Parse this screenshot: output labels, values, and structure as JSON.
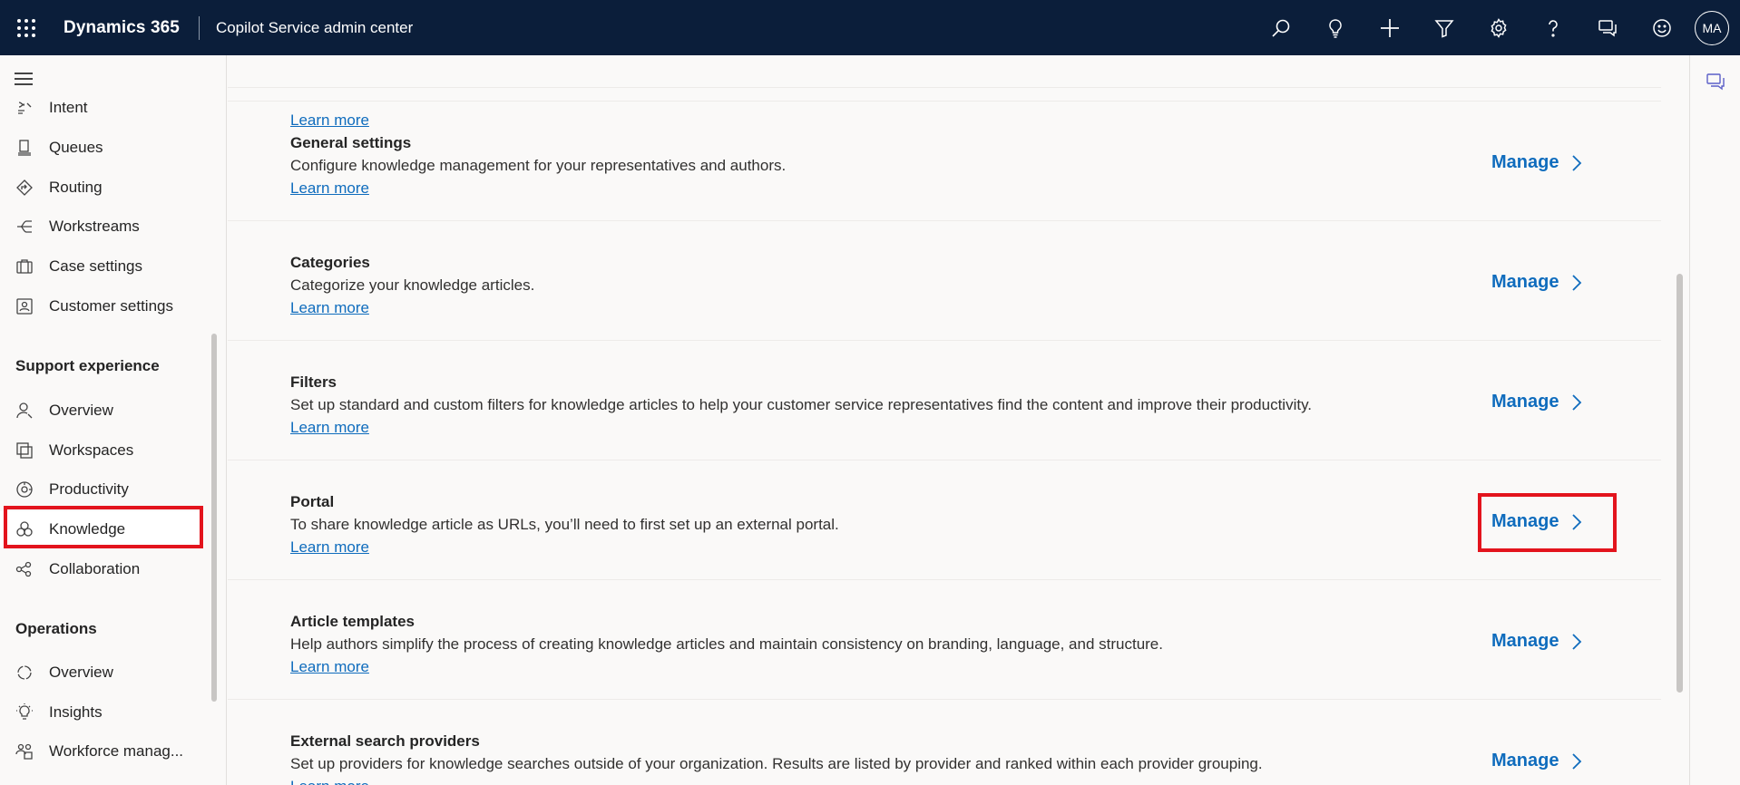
{
  "header": {
    "app_name": "Dynamics 365",
    "area_name": "Copilot Service admin center",
    "avatar_initials": "MA",
    "icons": [
      "search-icon",
      "lightbulb-icon",
      "plus-icon",
      "filter-icon",
      "gear-icon",
      "help-icon",
      "chat-icon",
      "smiley-icon"
    ]
  },
  "sidebar": {
    "items_top": [
      {
        "label": "Intent",
        "icon": "intent-icon"
      },
      {
        "label": "Queues",
        "icon": "queues-icon"
      },
      {
        "label": "Routing",
        "icon": "routing-icon"
      },
      {
        "label": "Workstreams",
        "icon": "workstreams-icon"
      },
      {
        "label": "Case settings",
        "icon": "briefcase-icon"
      },
      {
        "label": "Customer settings",
        "icon": "contact-card-icon"
      }
    ],
    "section_support": "Support experience",
    "items_support": [
      {
        "label": "Overview",
        "icon": "person-icon"
      },
      {
        "label": "Workspaces",
        "icon": "workspaces-icon"
      },
      {
        "label": "Productivity",
        "icon": "productivity-icon"
      },
      {
        "label": "Knowledge",
        "icon": "knowledge-icon",
        "selected": true
      },
      {
        "label": "Collaboration",
        "icon": "collaboration-icon"
      }
    ],
    "section_operations": "Operations",
    "items_operations": [
      {
        "label": "Overview",
        "icon": "overview-cycle-icon"
      },
      {
        "label": "Insights",
        "icon": "insights-icon"
      },
      {
        "label": "Workforce manag...",
        "icon": "workforce-icon"
      }
    ]
  },
  "main": {
    "top_partial_learn": "Learn more",
    "rows": [
      {
        "title": "General settings",
        "description": "Configure knowledge management for your representatives and authors.",
        "learn": "Learn more",
        "action": "Manage"
      },
      {
        "title": "Categories",
        "description": "Categorize your knowledge articles.",
        "learn": "Learn more",
        "action": "Manage"
      },
      {
        "title": "Filters",
        "description": "Set up standard and custom filters for knowledge articles to help your customer service representatives find the content and improve their productivity.",
        "learn": "Learn more",
        "action": "Manage"
      },
      {
        "title": "Portal",
        "description": "To share knowledge article as URLs, you’ll need to first set up an external portal.",
        "learn": "Learn more",
        "action": "Manage",
        "highlighted": true
      },
      {
        "title": "Article templates",
        "description": "Help authors simplify the process of creating knowledge articles and maintain consistency on branding, language, and structure.",
        "learn": "Learn more",
        "action": "Manage"
      },
      {
        "title": "External search providers",
        "description": "Set up providers for knowledge searches outside of your organization. Results are listed by provider and ranked within each provider grouping.",
        "learn": "Learn more",
        "action": "Manage"
      }
    ]
  },
  "colors": {
    "header_bg": "#0b1e3a",
    "link": "#0f6cbd",
    "highlight": "#e3141d"
  }
}
